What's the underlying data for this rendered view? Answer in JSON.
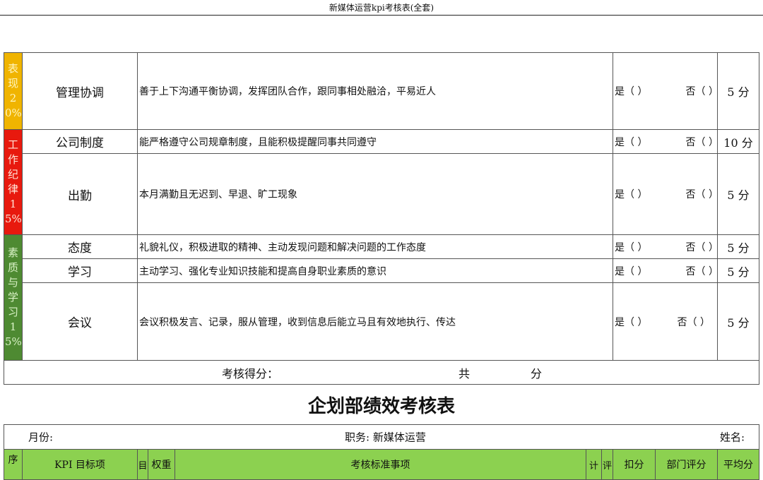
{
  "page_header": "新媒体运营kpi考核表(全套)",
  "rows": [
    {
      "item": "管理协调",
      "desc": "善于上下沟通平衡协调，发挥团队合作，跟同事相处融洽，平易近人",
      "yes": "是（ ）",
      "no": "否（ ）",
      "score": "5 分"
    },
    {
      "item": "公司制度",
      "desc": "能严格遵守公司规章制度，且能积极提醒同事共同遵守",
      "yes": "是（ ）",
      "no": "否（ ）",
      "score": "10 分"
    },
    {
      "item": "出勤",
      "desc": "本月满勤且无迟到、早退、旷工现象",
      "yes": "是（ ）",
      "no": "否（ ）",
      "score": "5 分"
    },
    {
      "item": "态度",
      "desc": "礼貌礼仪，积极进取的精神、主动发现问题和解决问题的工作态度",
      "yes": "是（ ）",
      "no": "否（ ）",
      "score": "5 分"
    },
    {
      "item": "学习",
      "desc": "主动学习、强化专业知识技能和提高自身职业素质的意识",
      "yes": "是（ ）",
      "no": "否（ ）",
      "score": "5 分"
    },
    {
      "item": "会议",
      "desc": "会议积极发言、记录，服从管理，收到信息后能立马且有效地执行、传达",
      "yes": "是（ ）",
      "no": "否（ ）",
      "score": "5 分"
    }
  ],
  "categories": {
    "performance": "表现20%",
    "discipline": "工作纪律15%",
    "quality": "素质与学习15%"
  },
  "total": {
    "label": "考核得分：",
    "gong": "共",
    "fen": "分"
  },
  "table2": {
    "title": "企划部绩效考核表",
    "month_label": "月份:",
    "position_label": "职务: 新媒体运营",
    "name_label": "姓名:",
    "columns": [
      "序",
      "KPI 目标项",
      "目",
      "权重",
      "考核标准事项",
      "计",
      "评",
      "扣分",
      "部门评分",
      "平均分"
    ]
  },
  "colors": {
    "yellow": "#f0b400",
    "red": "#e8190e",
    "green": "#4e8a32",
    "header_green": "#8cd150"
  }
}
